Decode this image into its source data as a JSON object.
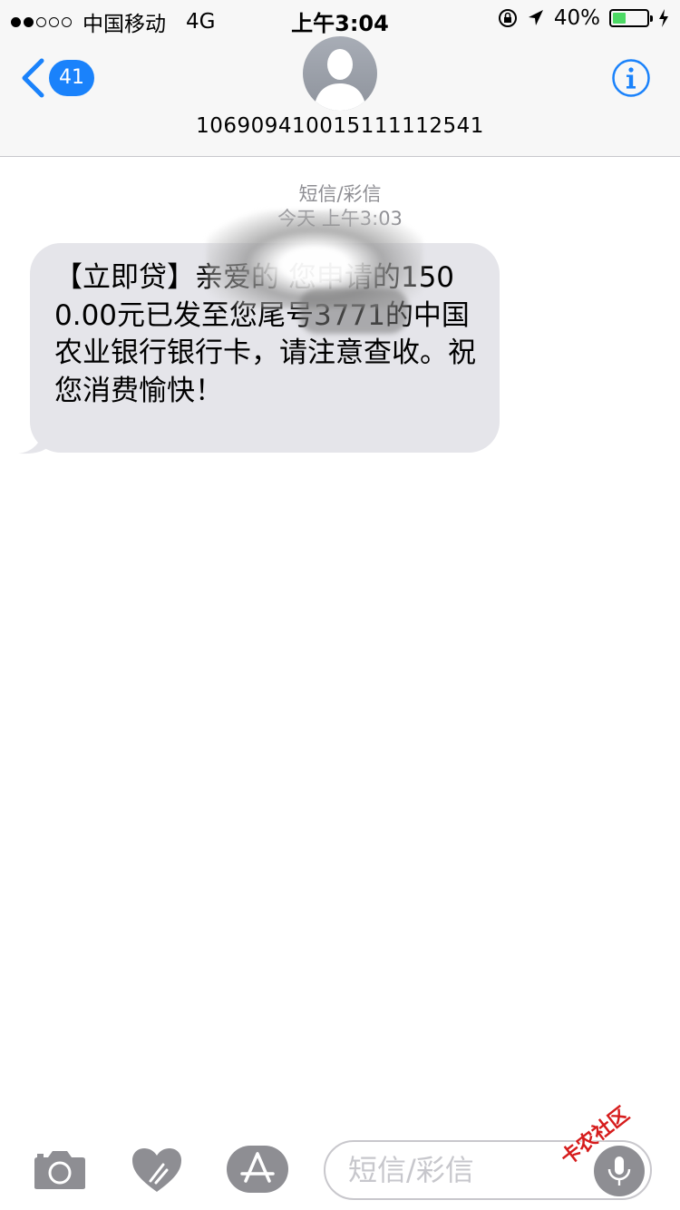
{
  "status_bar": {
    "signal_filled": 2,
    "signal_total": 5,
    "carrier": "中国移动",
    "network": "4G",
    "time": "上午3:04",
    "battery_percent": "40%",
    "battery_level": 0.4,
    "icons": [
      "lock-rotation-icon",
      "location-arrow-icon",
      "battery-icon",
      "charging-bolt-icon"
    ]
  },
  "header": {
    "back_badge": "41",
    "contact": "106909410015111112541",
    "accent": "#1a82fb"
  },
  "thread": {
    "message_type": "短信/彩信",
    "timestamp": "今天 上午3:03",
    "bubble_color": "#e5e5ea",
    "message_text": "【立即贷】亲爱的        您申请的1500.00元已发至您尾号3771的中国农业银行银行卡，请注意查收。祝您消费愉快！"
  },
  "compose": {
    "placeholder": "短信/彩信",
    "icons": [
      "camera-icon",
      "digital-touch-icon",
      "app-store-icon",
      "microphone-icon"
    ]
  },
  "watermark": "卡农社区"
}
